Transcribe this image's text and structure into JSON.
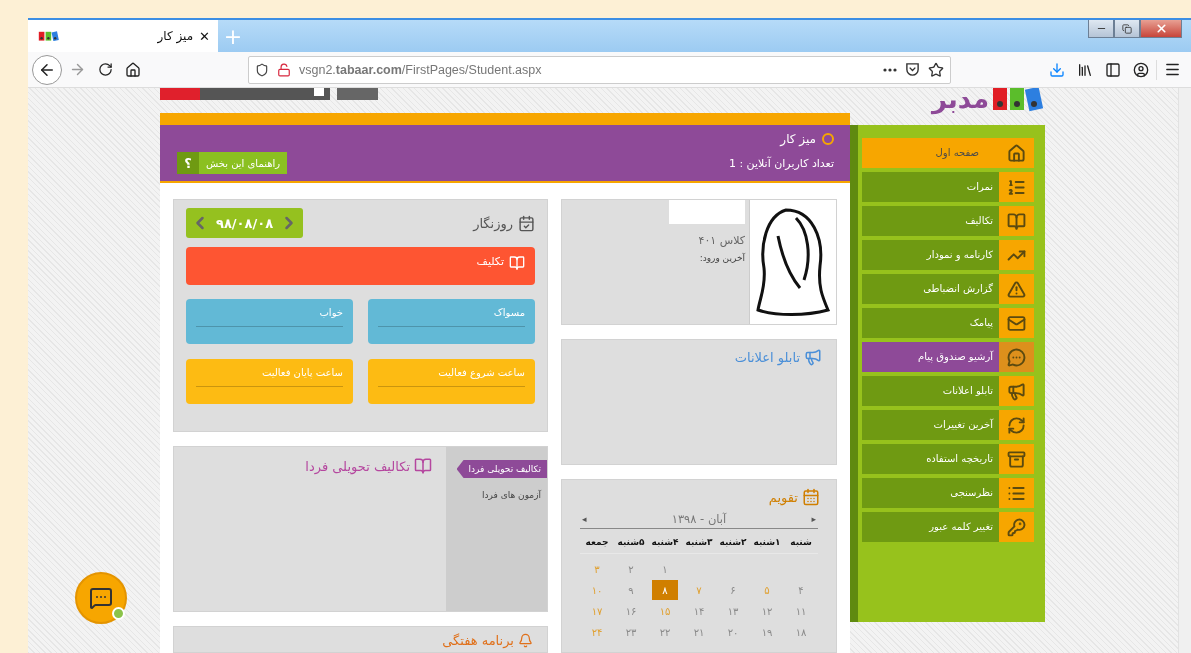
{
  "browser": {
    "tab": {
      "title": "میز کار",
      "close": "✕"
    },
    "new_tab": "+",
    "url": "vsgn2.**tabaar.com**/FirstPages/Student.aspx"
  },
  "logo": "مدبر",
  "header": {
    "title": "میز کار",
    "online": "تعداد کاربران آنلاین : 1",
    "help": {
      "icon": "؟",
      "label": "راهنمای این بخش"
    }
  },
  "sidebar": {
    "items": [
      {
        "label": "صفحه اول",
        "selected": true,
        "hovered": false
      },
      {
        "label": "نمرات",
        "selected": false,
        "hovered": false
      },
      {
        "label": "تکالیف",
        "selected": false,
        "hovered": false
      },
      {
        "label": "کارنامه و نمودار",
        "selected": false,
        "hovered": false
      },
      {
        "label": "گزارش انضباطی",
        "selected": false,
        "hovered": false
      },
      {
        "label": "پیامک",
        "selected": false,
        "hovered": false
      },
      {
        "label": "آرشیو صندوق پیام",
        "selected": false,
        "hovered": true
      },
      {
        "label": "تابلو اعلانات",
        "selected": false,
        "hovered": false
      },
      {
        "label": "آخرین تغییرات",
        "selected": false,
        "hovered": false
      },
      {
        "label": "تاریخچه استفاده",
        "selected": false,
        "hovered": false
      },
      {
        "label": "نظرسنجی",
        "selected": false,
        "hovered": false
      },
      {
        "label": "تغییر کلمه عبور",
        "selected": false,
        "hovered": false
      }
    ]
  },
  "diary": {
    "title": "روزنگار",
    "date": "۹۸/۰۸/۰۸",
    "task": "تکلیف",
    "fields": [
      {
        "label": "مسواک",
        "color": "#62b9d6"
      },
      {
        "label": "خواب",
        "color": "#62b9d6"
      },
      {
        "label": "ساعت شروع فعالیت",
        "color": "#fdbb13"
      },
      {
        "label": "ساعت پایان فعالیت",
        "color": "#fdbb13"
      }
    ]
  },
  "tomorrow": {
    "title": "تکالیف تحویلی فردا",
    "tabs": [
      {
        "label": "تکالیف تحویلی فردا",
        "selected": true
      },
      {
        "label": "آزمون های فردا",
        "selected": false
      }
    ]
  },
  "weekly": {
    "title": "برنامه هفتگی"
  },
  "profile": {
    "class": "کلاس ۴۰۱",
    "last_login": "آخرین ورود:"
  },
  "announcements": {
    "title": "تابلو اعلانات"
  },
  "calendar": {
    "title": "تقویم",
    "month": "آبان - ۱۳۹۸",
    "prev": "▸",
    "next": "◂",
    "weekdays": [
      "شنبه",
      "۱شنبه",
      "۲شنبه",
      "۳شنبه",
      "۴شنبه",
      "۵شنبه",
      "جمعه"
    ],
    "weeks": [
      [
        {
          "label": "۱",
          "selected": false,
          "holiday": false
        },
        {
          "label": "۲",
          "selected": false,
          "holiday": false
        },
        {
          "label": "۳",
          "selected": false,
          "holiday": true
        }
      ],
      [
        {
          "label": "۴",
          "selected": false,
          "holiday": false
        },
        {
          "label": "۵",
          "selected": false,
          "holiday": true
        },
        {
          "label": "۶",
          "selected": false,
          "holiday": false
        },
        {
          "label": "۷",
          "selected": false,
          "holiday": true
        },
        {
          "label": "۸",
          "selected": true,
          "holiday": false
        },
        {
          "label": "۹",
          "selected": false,
          "holiday": false
        },
        {
          "label": "۱۰",
          "selected": false,
          "holiday": true
        }
      ],
      [
        {
          "label": "۱۱",
          "selected": false,
          "holiday": false
        },
        {
          "label": "۱۲",
          "selected": false,
          "holiday": false
        },
        {
          "label": "۱۳",
          "selected": false,
          "holiday": false
        },
        {
          "label": "۱۴",
          "selected": false,
          "holiday": false
        },
        {
          "label": "۱۵",
          "selected": false,
          "holiday": true
        },
        {
          "label": "۱۶",
          "selected": false,
          "holiday": false
        },
        {
          "label": "۱۷",
          "selected": false,
          "holiday": true
        }
      ],
      [
        {
          "label": "۱۸",
          "selected": false,
          "holiday": false
        },
        {
          "label": "۱۹",
          "selected": false,
          "holiday": false
        },
        {
          "label": "۲۰",
          "selected": false,
          "holiday": false
        },
        {
          "label": "۲۱",
          "selected": false,
          "holiday": false
        },
        {
          "label": "۲۲",
          "selected": false,
          "holiday": false
        },
        {
          "label": "۲۳",
          "selected": false,
          "holiday": false
        },
        {
          "label": "۲۴",
          "selected": false,
          "holiday": true
        }
      ]
    ]
  }
}
